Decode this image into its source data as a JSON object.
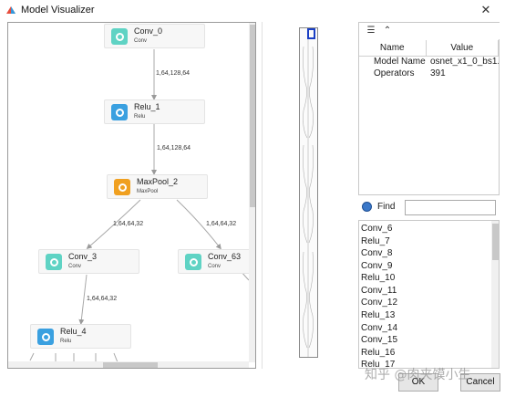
{
  "window": {
    "title": "Model Visualizer",
    "close_glyph": "✕",
    "icon": "app-logo-icon"
  },
  "graph": {
    "nodes": [
      {
        "name": "Conv_0",
        "type": "Conv",
        "icon_color": "#5fd3c4"
      },
      {
        "name": "Relu_1",
        "type": "Relu",
        "icon_color": "#3aa0e0"
      },
      {
        "name": "MaxPool_2",
        "type": "MaxPool",
        "icon_color": "#f0a020"
      },
      {
        "name": "Conv_3",
        "type": "Conv",
        "icon_color": "#5fd3c4"
      },
      {
        "name": "Conv_63",
        "type": "Conv",
        "icon_color": "#5fd3c4"
      },
      {
        "name": "Relu_4",
        "type": "Relu",
        "icon_color": "#3aa0e0"
      }
    ],
    "edge_labels": [
      "1,64,128,64",
      "1,64,128,64",
      "1,64,64,32",
      "1,64,64,32",
      "1,64,64,32"
    ]
  },
  "toolbar": {
    "expand_icon": "list-expand-icon",
    "collapse_icon": "chevron-up-icon"
  },
  "properties": {
    "col_name": "Name",
    "col_value": "Value",
    "rows": [
      {
        "key": "Model Name",
        "value": "osnet_x1_0_bs1..."
      },
      {
        "key": "Operators",
        "value": "391"
      }
    ]
  },
  "find": {
    "label": "Find",
    "value": ""
  },
  "operators": [
    "Conv_6",
    "Relu_7",
    "Conv_8",
    "Conv_9",
    "Relu_10",
    "Conv_11",
    "Conv_12",
    "Relu_13",
    "Conv_14",
    "Conv_15",
    "Relu_16",
    "Relu_17"
  ],
  "buttons": {
    "ok": "OK",
    "cancel": "Cancel"
  },
  "watermark": "知乎 @肉夹馍小生",
  "colors": {
    "conv": "#5fd3c4",
    "relu": "#3aa0e0",
    "maxpool": "#f0a020",
    "minimap_view": "#1a3fc4"
  }
}
